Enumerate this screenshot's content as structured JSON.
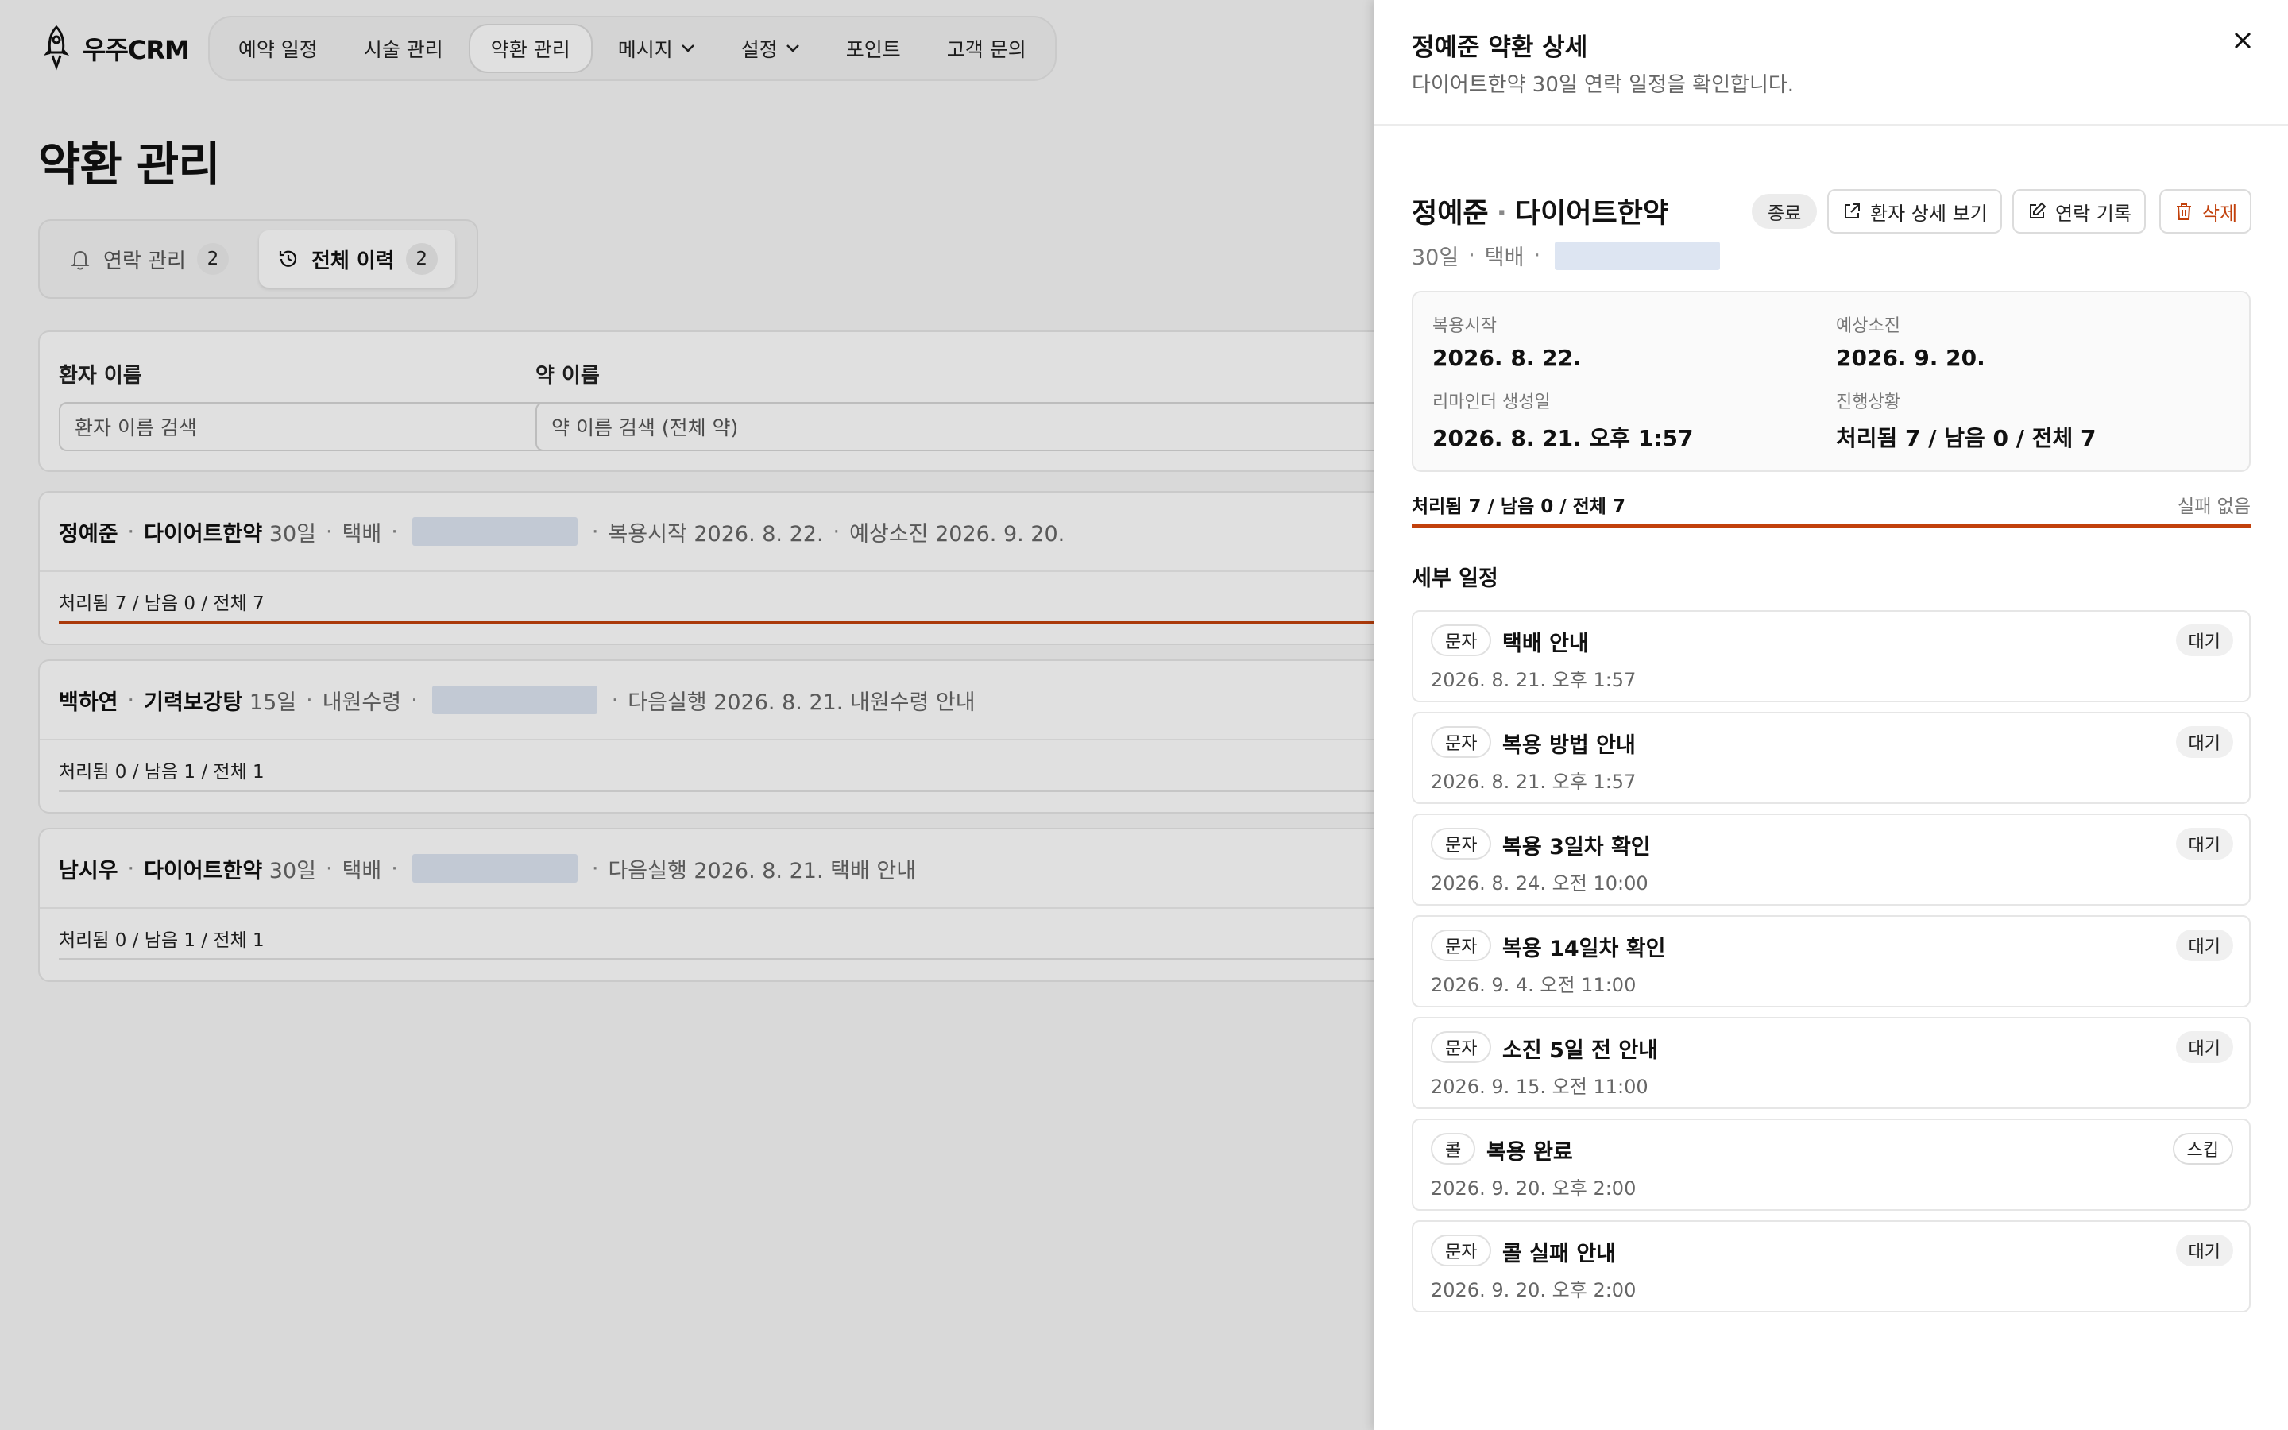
{
  "app": {
    "logo_text": "우주CRM",
    "nav": [
      "예약 일정",
      "시술 관리",
      "약환 관리",
      "메시지",
      "설정",
      "포인트",
      "고객 문의"
    ],
    "page_title": "약환 관리"
  },
  "tabs": [
    {
      "label": "연락 관리",
      "count": "2"
    },
    {
      "label": "전체 이력",
      "count": "2"
    }
  ],
  "filters": {
    "patient_label": "환자 이름",
    "patient_placeholder": "환자 이름 검색",
    "drug_label": "약 이름",
    "drug_placeholder": "약 이름 검색 (전체 약)"
  },
  "records": [
    {
      "name": "정예준",
      "drug": "다이어트한약",
      "days": "30일",
      "method": "택배",
      "extra": "복용시작 2026. 8. 22.",
      "extra2": "예상소진 2026. 9. 20.",
      "progress": "처리됨 7 / 남음 0 / 전체 7",
      "ratio": 1.0
    },
    {
      "name": "백하연",
      "drug": "기력보강탕",
      "days": "15일",
      "method": "내원수령",
      "extra": "다음실행 2026. 8. 21. 내원수령 안내",
      "extra2": "",
      "progress": "처리됨 0 / 남음 1 / 전체 1",
      "ratio": 0
    },
    {
      "name": "남시우",
      "drug": "다이어트한약",
      "days": "30일",
      "method": "택배",
      "extra": "다음실행 2026. 8. 21. 택배 안내",
      "extra2": "",
      "progress": "처리됨 0 / 남음 1 / 전체 1",
      "ratio": 0
    }
  ],
  "drawer": {
    "title": "정예준 약환 상세",
    "subtitle": "다이어트한약 30일 연락 일정을 확인합니다.",
    "patient": "정예준",
    "drug": "다이어트한약",
    "days": "30일",
    "method": "택배",
    "status": "종료",
    "btn_patient": "환자 상세 보기",
    "btn_contact": "연락 기록",
    "btn_delete": "삭제",
    "info": {
      "start_label": "복용시작",
      "start_value": "2026. 8. 22.",
      "end_label": "예상소진",
      "end_value": "2026. 9. 20.",
      "created_label": "리마인더 생성일",
      "created_value": "2026. 8. 21. 오후 1:57",
      "state_label": "진행상황",
      "state_value": "처리됨 7 / 남음 0 / 전체 7"
    },
    "progress_text": "처리됨 7 / 남음 0 / 전체 7",
    "progress_ratio": 1.0,
    "fail_text": "실패 없음",
    "schedule_title": "세부 일정",
    "schedule": [
      {
        "type": "문자",
        "name": "택배 안내",
        "date": "2026. 8. 21. 오후 1:57",
        "state": "대기"
      },
      {
        "type": "문자",
        "name": "복용 방법 안내",
        "date": "2026. 8. 21. 오후 1:57",
        "state": "대기"
      },
      {
        "type": "문자",
        "name": "복용 3일차 확인",
        "date": "2026. 8. 24. 오전 10:00",
        "state": "대기"
      },
      {
        "type": "문자",
        "name": "복용 14일차 확인",
        "date": "2026. 9. 4. 오전 11:00",
        "state": "대기"
      },
      {
        "type": "문자",
        "name": "소진 5일 전 안내",
        "date": "2026. 9. 15. 오전 11:00",
        "state": "대기"
      },
      {
        "type": "콜",
        "name": "복용 완료",
        "date": "2026. 9. 20. 오후 2:00",
        "state": "스킵"
      },
      {
        "type": "문자",
        "name": "콜 실패 안내",
        "date": "2026. 9. 20. 오후 2:00",
        "state": "대기"
      }
    ]
  },
  "colors": {
    "accent": "#c2410c",
    "redaction": "#dde5f2"
  }
}
